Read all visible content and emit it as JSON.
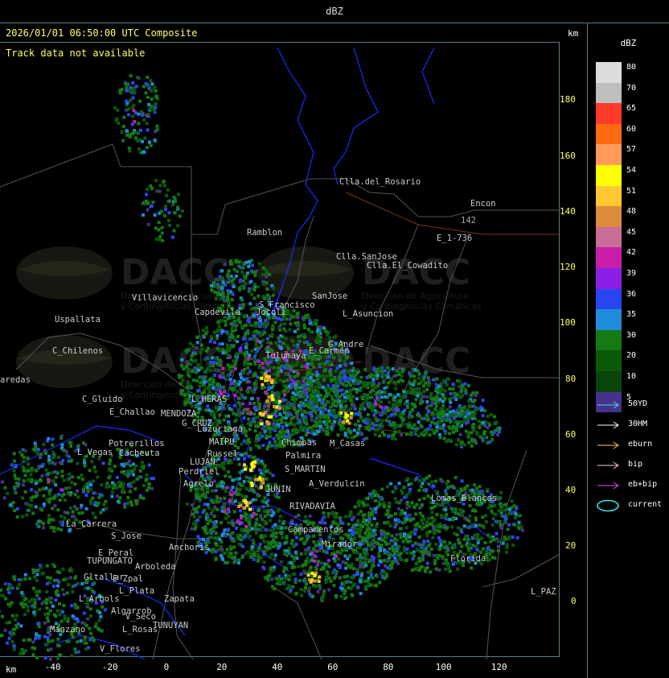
{
  "window": {
    "title": "dBZ"
  },
  "header": {
    "timestamp": "2026/01/01 06:50:00 UTC Composite",
    "notice": "Track data not available",
    "km_top": "km",
    "km_bottom": "km"
  },
  "axes": {
    "y_ticks": [
      "180",
      "160",
      "140",
      "120",
      "100",
      "80",
      "60",
      "40",
      "20",
      "0"
    ],
    "x_ticks": [
      "-40",
      "-20",
      "0",
      "20",
      "40",
      "60",
      "80",
      "100",
      "120"
    ]
  },
  "watermark": {
    "brand": "DACC",
    "line1": "Dirección de Agricultura",
    "line2": "y Contingencias Climáticas"
  },
  "places": [
    {
      "name": "Clla.del_Rosario",
      "color": "#ccc"
    },
    {
      "name": "Encon",
      "color": "#ccc"
    },
    {
      "name": "142",
      "color": "#aaa"
    },
    {
      "name": "E_1-736",
      "color": "#ccc"
    },
    {
      "name": "Ramblon",
      "color": "#ccc"
    },
    {
      "name": "Clla.SanJose",
      "color": "#ccc"
    },
    {
      "name": "Clla.El_Cowadito",
      "color": "#ccc"
    },
    {
      "name": "Villavicencio",
      "color": "#ccc"
    },
    {
      "name": "S_Francisco",
      "color": "#ccc"
    },
    {
      "name": "SanJose",
      "color": "#ccc"
    },
    {
      "name": "Capdevila",
      "color": "#ccc"
    },
    {
      "name": "Jocoli",
      "color": "#ccc"
    },
    {
      "name": "L_Asuncion",
      "color": "#ccc"
    },
    {
      "name": "Uspallata",
      "color": "#ccc"
    },
    {
      "name": "C_Chilenos",
      "color": "#ccc"
    },
    {
      "name": "E_Carmen",
      "color": "#ccc"
    },
    {
      "name": "G_Andre",
      "color": "#ccc"
    },
    {
      "name": "Tulumaya",
      "color": "#ccc"
    },
    {
      "name": "C_Gluido",
      "color": "#ccc"
    },
    {
      "name": "E_Challao",
      "color": "#ccc"
    },
    {
      "name": "L_HERAS",
      "color": "#ccc"
    },
    {
      "name": "MENDOZA",
      "color": "#ccc"
    },
    {
      "name": "G_CRUZ",
      "color": "#ccc"
    },
    {
      "name": "Luzuriaga",
      "color": "#ccc"
    },
    {
      "name": "MAIPU",
      "color": "#ccc"
    },
    {
      "name": "Potrerillos",
      "color": "#ccc"
    },
    {
      "name": "L_Vegas",
      "color": "#ccc"
    },
    {
      "name": "Cacheuta",
      "color": "#ccc"
    },
    {
      "name": "Russel",
      "color": "#ccc"
    },
    {
      "name": "LUJAN",
      "color": "#ccc"
    },
    {
      "name": "Perdriel",
      "color": "#ccc"
    },
    {
      "name": "Agrelo",
      "color": "#ccc"
    },
    {
      "name": "Palmira",
      "color": "#ccc"
    },
    {
      "name": "S_MARTIN",
      "color": "#ccc"
    },
    {
      "name": "A_Verdulcin",
      "color": "#ccc"
    },
    {
      "name": "JUNIN",
      "color": "#ccc"
    },
    {
      "name": "M_Casas",
      "color": "#ccc"
    },
    {
      "name": "Chimbas",
      "color": "#ccc"
    },
    {
      "name": "RIVADAVIA",
      "color": "#ccc"
    },
    {
      "name": "Lomas_Blancas",
      "color": "#ccc"
    },
    {
      "name": "La_Carrera",
      "color": "#ccc"
    },
    {
      "name": "S_Jose",
      "color": "#ccc"
    },
    {
      "name": "E_Peral",
      "color": "#ccc"
    },
    {
      "name": "TUPUNGATO",
      "color": "#ccc"
    },
    {
      "name": "Anchoris",
      "color": "#ccc"
    },
    {
      "name": "Campamentos",
      "color": "#ccc"
    },
    {
      "name": "Mirador",
      "color": "#ccc"
    },
    {
      "name": "Florida",
      "color": "#ccc"
    },
    {
      "name": "Arboleda",
      "color": "#ccc"
    },
    {
      "name": "Gltallar",
      "color": "#ccc"
    },
    {
      "name": "E_Zpal",
      "color": "#ccc"
    },
    {
      "name": "L_Arbols",
      "color": "#ccc"
    },
    {
      "name": "L_Plata",
      "color": "#ccc"
    },
    {
      "name": "Zapata",
      "color": "#ccc"
    },
    {
      "name": "Algarrob",
      "color": "#ccc"
    },
    {
      "name": "Manzano",
      "color": "#ccc"
    },
    {
      "name": "L_Rosas",
      "color": "#ccc"
    },
    {
      "name": "TUNUYAN",
      "color": "#ccc"
    },
    {
      "name": "V_Seco",
      "color": "#ccc"
    },
    {
      "name": "V_Flores",
      "color": "#ccc"
    },
    {
      "name": "L_PAZ",
      "color": "#ccc"
    },
    {
      "name": "aredas",
      "color": "#ccc"
    }
  ],
  "legend": {
    "title": "dBZ",
    "scale": [
      {
        "value": "80",
        "color": "#dcdcdc"
      },
      {
        "value": "70",
        "color": "#bebebe"
      },
      {
        "value": "65",
        "color": "#ff3a28"
      },
      {
        "value": "60",
        "color": "#ff6a10"
      },
      {
        "value": "57",
        "color": "#ff9a5a"
      },
      {
        "value": "54",
        "color": "#ffff00"
      },
      {
        "value": "51",
        "color": "#ffc832"
      },
      {
        "value": "48",
        "color": "#dc8c3c"
      },
      {
        "value": "45",
        "color": "#c86e96"
      },
      {
        "value": "42",
        "color": "#c81eaa"
      },
      {
        "value": "39",
        "color": "#8c1ee6"
      },
      {
        "value": "36",
        "color": "#2846f0"
      },
      {
        "value": "35",
        "color": "#1e8cdc"
      },
      {
        "value": "30",
        "color": "#147a14"
      },
      {
        "value": "20",
        "color": "#0a5a0a"
      },
      {
        "value": "10",
        "color": "#0a460a"
      },
      {
        "value": "5",
        "color": "#46328c"
      }
    ],
    "tracks": [
      {
        "label": "50YD",
        "color": "#40e0e0"
      },
      {
        "label": "30HM",
        "color": "#ffffff"
      },
      {
        "label": "eburn",
        "color": "#ffc860"
      },
      {
        "label": "bip",
        "color": "#ffc8c8"
      },
      {
        "label": "eb+bip",
        "color": "#ff40ff"
      },
      {
        "label": "current",
        "color": "#40e0e0"
      }
    ]
  }
}
